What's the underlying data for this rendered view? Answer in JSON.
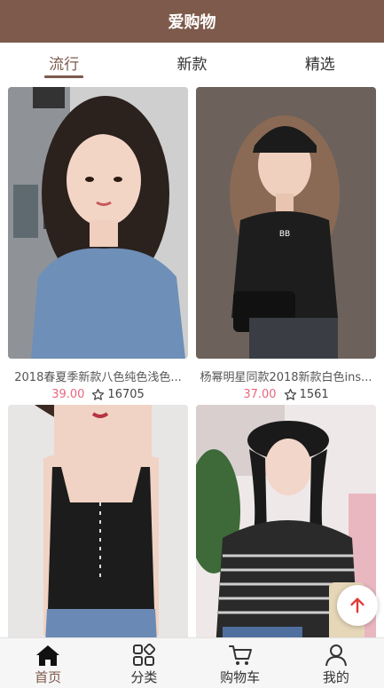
{
  "header": {
    "title": "爱购物"
  },
  "tabs": [
    {
      "label": "流行",
      "active": true
    },
    {
      "label": "新款",
      "active": false
    },
    {
      "label": "精选",
      "active": false
    }
  ],
  "products": [
    {
      "title": "2018春夏季新款八色纯色浅色...",
      "price": "39.00",
      "favorites": "16705"
    },
    {
      "title": "杨幂明星同款2018新款白色ins...",
      "price": "37.00",
      "favorites": "1561"
    },
    {
      "title": "",
      "price": "",
      "favorites": ""
    },
    {
      "title": "",
      "price": "",
      "favorites": ""
    }
  ],
  "bottom_nav": [
    {
      "label": "首页",
      "icon": "home-icon",
      "active": true
    },
    {
      "label": "分类",
      "icon": "category-icon",
      "active": false
    },
    {
      "label": "购物车",
      "icon": "cart-icon",
      "active": false
    },
    {
      "label": "我的",
      "icon": "user-icon",
      "active": false
    }
  ],
  "colors": {
    "brand": "#7d5a4b",
    "price": "#e8677d",
    "back_to_top_arrow": "#e03a3a"
  }
}
